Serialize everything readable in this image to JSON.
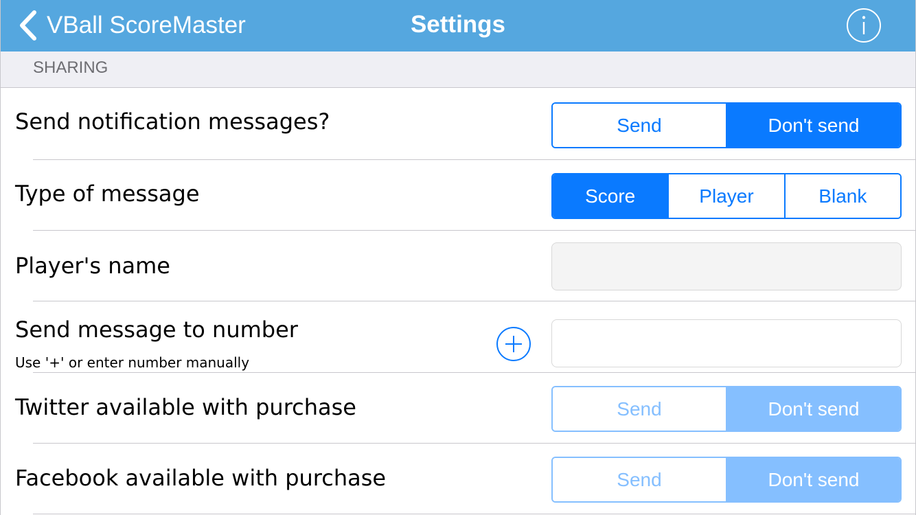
{
  "navbar": {
    "back_label": "VBall ScoreMaster",
    "title": "Settings",
    "info_icon": "info-circle-icon",
    "back_icon": "chevron-left-icon"
  },
  "section": {
    "header": "SHARING"
  },
  "rows": {
    "notifications": {
      "label": "Send notification messages?",
      "options": [
        "Send",
        "Don't send"
      ],
      "selected": "Don't send"
    },
    "message_type": {
      "label": "Type of message",
      "options": [
        "Score",
        "Player",
        "Blank"
      ],
      "selected": "Score"
    },
    "player_name": {
      "label": "Player's name",
      "value": "",
      "placeholder": ""
    },
    "send_to_number": {
      "label": "Send message to number",
      "sublabel": "Use '+' or enter number manually",
      "value": "",
      "placeholder": "",
      "add_icon": "plus-circle-icon"
    },
    "twitter": {
      "label": "Twitter available with purchase",
      "options": [
        "Send",
        "Don't send"
      ],
      "selected": "Don't send",
      "enabled": false
    },
    "facebook": {
      "label": "Facebook available with purchase",
      "options": [
        "Send",
        "Don't send"
      ],
      "selected": "Don't send",
      "enabled": false
    }
  },
  "colors": {
    "navbar": "#55a7df",
    "accent": "#0a7aff",
    "disabled_accent": "#85bfff",
    "section_bg": "#efeff4",
    "separator": "#c8c7cc"
  }
}
